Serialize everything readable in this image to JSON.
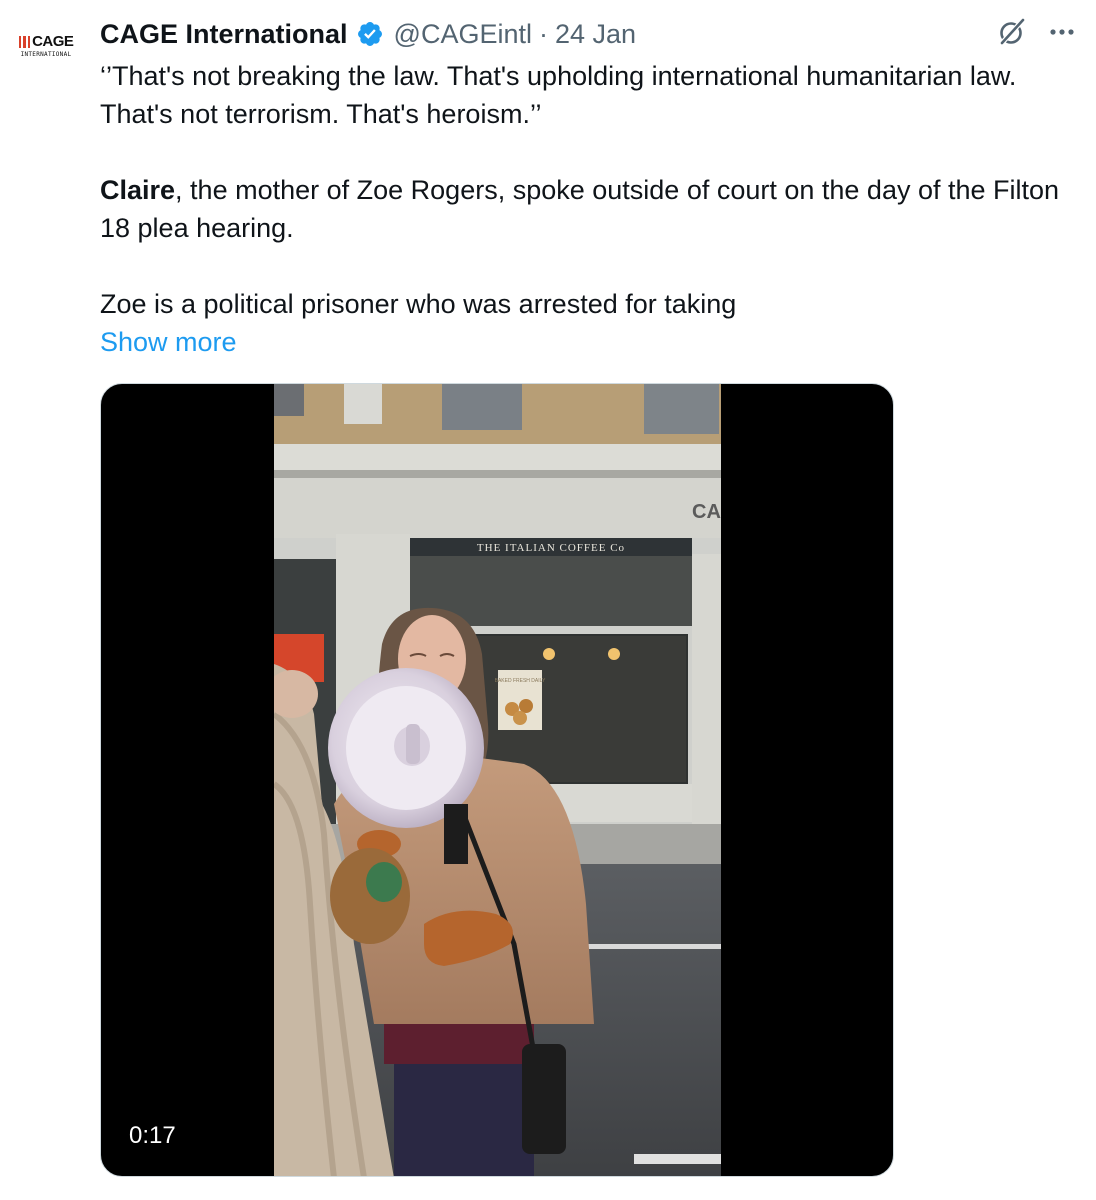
{
  "author": {
    "display_name": "CAGE International",
    "handle": "@CAGEintl",
    "separator": "·",
    "date": "24 Jan",
    "logo": {
      "wordmark": "CAGE",
      "subtitle": "INTERNATIONAL"
    },
    "verified_icon": "verified-badge-icon",
    "verified_color": "#1d9bf0"
  },
  "actions": {
    "grok_icon": "grok-icon",
    "more_icon": "more-horizontal-icon"
  },
  "body": {
    "quote": "‘’That's not breaking the law. That's upholding international humanitarian law. That's not terrorism. That's heroism.’’",
    "para2_bold": "Claire",
    "para2_rest": ", the mother of Zoe Rogers, spoke outside of court on the day of the Filton 18 plea hearing.",
    "para3": "Zoe is a political prisoner who was arrested for taking",
    "show_more": "Show more"
  },
  "media": {
    "type": "video",
    "duration": "0:17",
    "storefront_sign": "THE ITALIAN COFFEE Co",
    "storefront_partial": "CA",
    "poster_text": "BAKED FRESH DAILY"
  },
  "colors": {
    "link": "#1d9bf0",
    "secondary_text": "#536471",
    "primary_text": "#0f1419",
    "logo_accent": "#d9412b"
  }
}
